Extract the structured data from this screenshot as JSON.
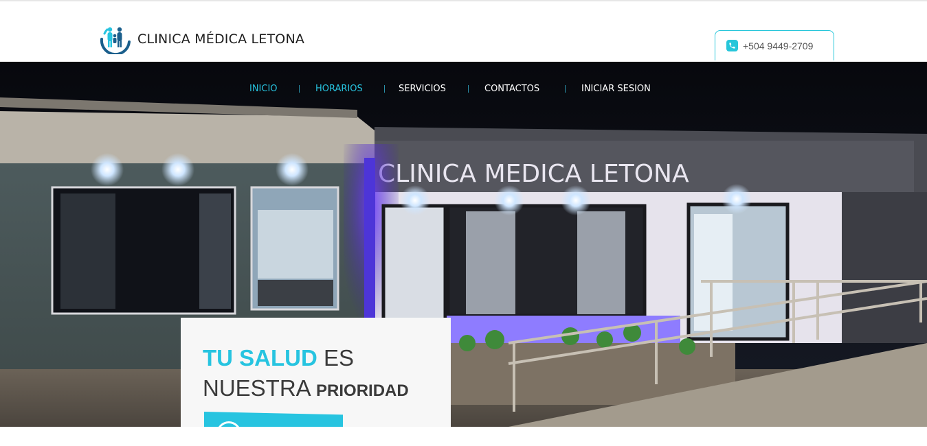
{
  "brand": {
    "name": "CLINICA MÉDICA LETONA",
    "phone": "+504 9449-2709"
  },
  "nav": {
    "items": [
      {
        "label": "INICIO",
        "active": true
      },
      {
        "label": "HORARIOS",
        "active": true
      },
      {
        "label": "SERVICIOS",
        "active": false
      },
      {
        "label": "CONTACTOS",
        "active": false
      },
      {
        "label": "INICIAR SESION",
        "active": false
      }
    ]
  },
  "hero": {
    "sign_text": "CLINICA MEDICA LETONA",
    "tagline": {
      "highlight": "TU SALUD",
      "word2": "ES",
      "word3": "NUESTRA",
      "bold": "PRIORIDAD"
    }
  },
  "colors": {
    "accent": "#27c4e0",
    "text_dark": "#3a3a3a",
    "logo_blue": "#1b5f8c"
  },
  "icons": {
    "logo": "family-logo-icon",
    "phone": "phone-icon",
    "cta": "circle-icon"
  }
}
